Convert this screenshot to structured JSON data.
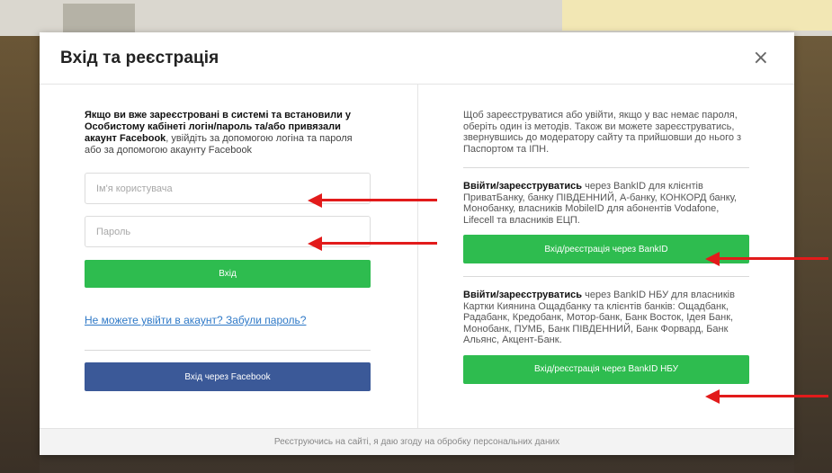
{
  "modal": {
    "title": "Вхід та реєстрація",
    "close_glyph": "×"
  },
  "left": {
    "intro_bold": "Якщо ви вже зареєстровані в системі та встановили у Особистому кабінеті логін/пароль та/або привязали акаунт Facebook",
    "intro_rest": ", увійдіть за допомогою логіна та пароля або за допомогою акаунту Facebook",
    "username_placeholder": "Ім'я користувача",
    "password_placeholder": "Пароль",
    "login_label": "Вхід",
    "forgot_link": "Не можете увійти в акаунт? Забули пароль?",
    "facebook_label": "Вхід через Facebook"
  },
  "right": {
    "intro": "Щоб зареєструватися або увійти, якщо у вас немає пароля, оберіть один із методів. Також ви можете зареєструватись, звернувшись до модератору сайту та прийшовши до нього з Паспортом та ІПН.",
    "bankid_bold": "Ввійти/зареєструватись",
    "bankid_rest": " через BankID для клієнтів ПриватБанку, банку ПІВДЕННИЙ, А-банку, КОНКОРД банку, Монобанку, власників MobileID для абонентів Vodafone, Lifecell та власників ЕЦП.",
    "bankid_button": "Вхід/реєстрація через BankID",
    "nbu_bold": "Ввійти/зареєструватись",
    "nbu_rest": " через BankID НБУ для власників Картки Киянина Ощадбанку та клієнтів банків: Ощадбанк, Радабанк, Кредобанк, Мотор-банк, Банк Восток, Ідея Банк, Монобанк, ПУМБ, Банк ПІВДЕННИЙ, Банк Форвард, Банк Альянс, Акцент-Банк.",
    "nbu_button": "Вхід/реєстрація через BankID НБУ"
  },
  "footer": {
    "consent": "Реєструючись на сайті, я даю згоду на обробку персональних даних"
  },
  "colors": {
    "green": "#2ebc4f",
    "facebook": "#3b5998",
    "link": "#2f79c7",
    "arrow": "#e21b1b"
  }
}
